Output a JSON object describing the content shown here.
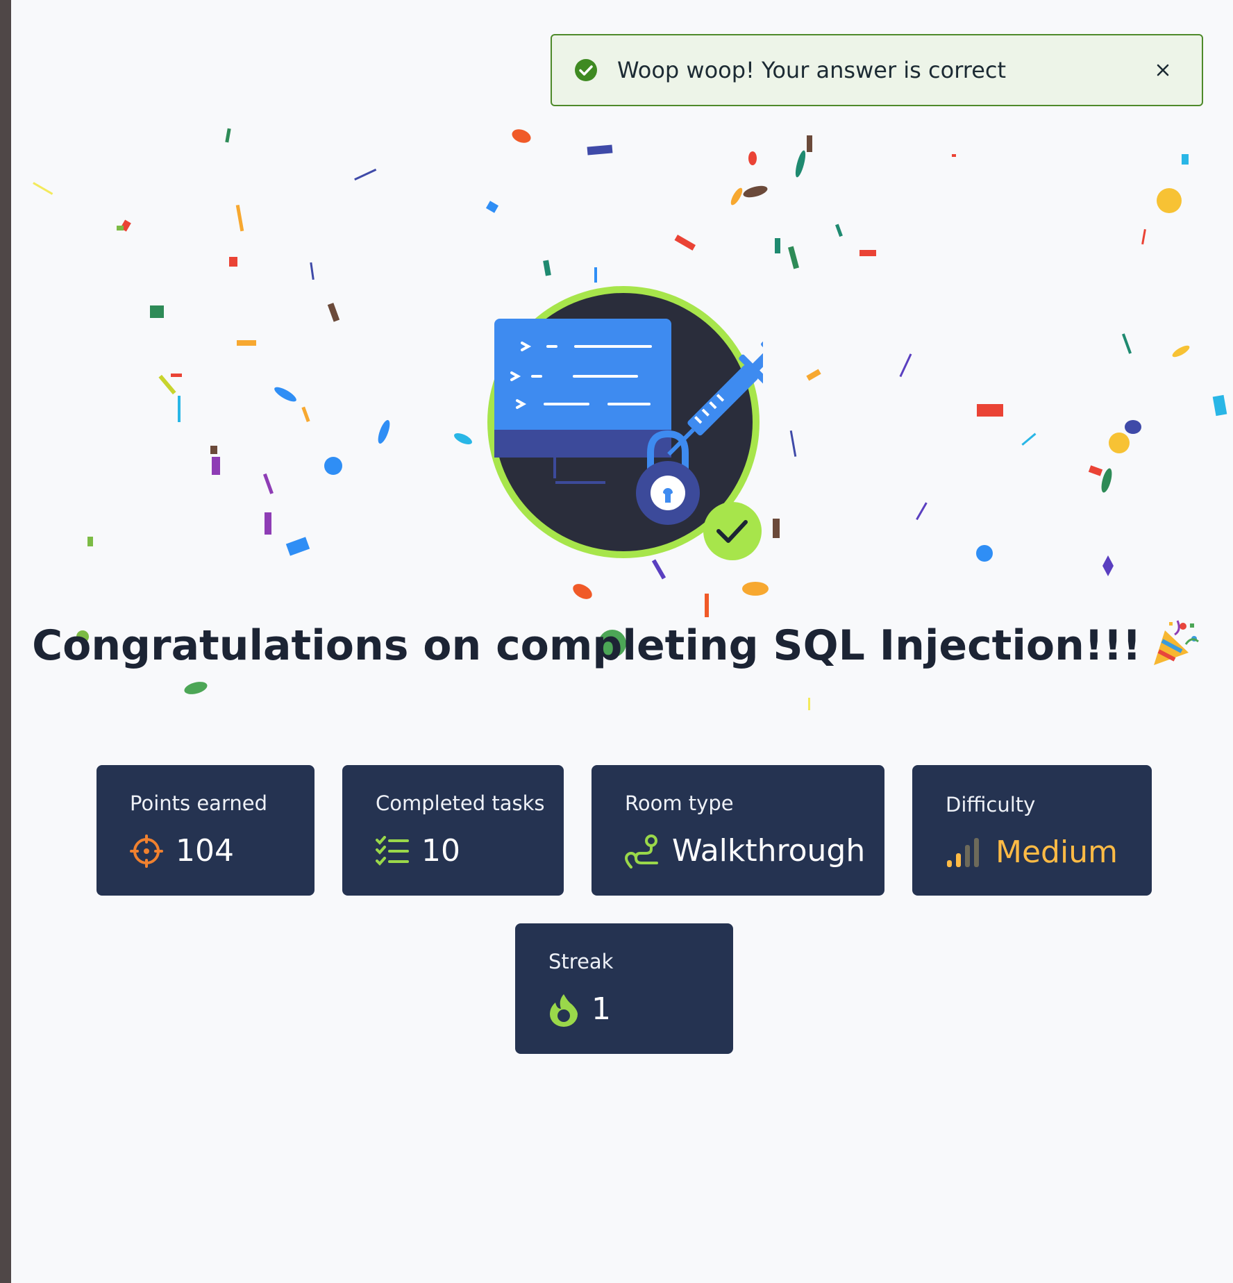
{
  "toast": {
    "message": "Woop woop! Your answer is correct",
    "icon": "check-circle-icon",
    "close_icon": "close-icon",
    "color": "#4e8a2a"
  },
  "badge": {
    "icon": "sql-injection-room-badge",
    "check_icon": "check-icon"
  },
  "headline": {
    "text": "Congratulations on completing SQL Injection!!!",
    "emoji": "party-popper-icon"
  },
  "stats": {
    "points": {
      "label": "Points earned",
      "value": "104",
      "icon": "target-icon",
      "color": "#f0812f"
    },
    "tasks": {
      "label": "Completed tasks",
      "value": "10",
      "icon": "checklist-icon",
      "color": "#9ad84a"
    },
    "room_type": {
      "label": "Room type",
      "value": "Walkthrough",
      "icon": "route-icon",
      "color": "#9ad84a"
    },
    "difficulty": {
      "label": "Difficulty",
      "value": "Medium",
      "icon": "signal-bars-icon",
      "color": "#ffbb45"
    },
    "streak": {
      "label": "Streak",
      "value": "1",
      "icon": "flame-icon",
      "color": "#9ad84a"
    }
  }
}
